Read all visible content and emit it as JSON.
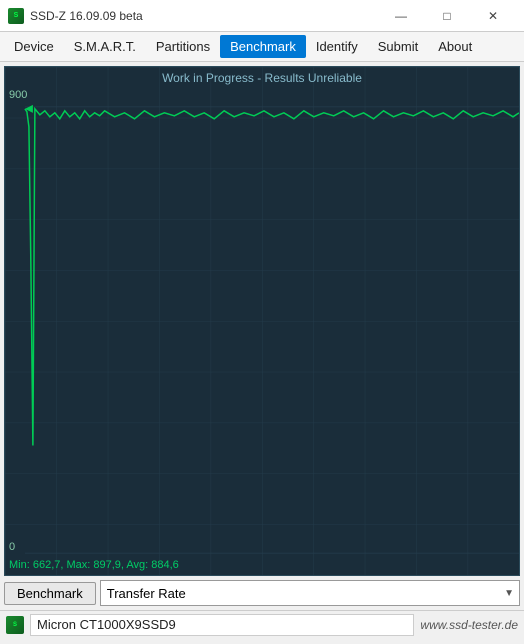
{
  "titleBar": {
    "icon": "SSD",
    "title": "SSD-Z 16.09.09 beta",
    "controls": {
      "minimize": "—",
      "maximize": "□",
      "close": "✕"
    }
  },
  "menuBar": {
    "items": [
      {
        "id": "device",
        "label": "Device",
        "active": false
      },
      {
        "id": "smart",
        "label": "S.M.A.R.T.",
        "active": false
      },
      {
        "id": "partitions",
        "label": "Partitions",
        "active": false
      },
      {
        "id": "benchmark",
        "label": "Benchmark",
        "active": true
      },
      {
        "id": "identify",
        "label": "Identify",
        "active": false
      },
      {
        "id": "submit",
        "label": "Submit",
        "active": false
      },
      {
        "id": "about",
        "label": "About",
        "active": false
      }
    ]
  },
  "chart": {
    "topLabel": "Work in Progress - Results Unreliable",
    "yMax": "900",
    "yMin": "0",
    "stats": "Min: 662,7, Max: 897,9, Avg: 884,6",
    "bgColor": "#1a2d3a",
    "gridColor": "#243d4d",
    "lineColor": "#00cc55"
  },
  "toolbar": {
    "benchmarkLabel": "Benchmark",
    "selectOptions": [
      "Transfer Rate"
    ],
    "selectValue": "Transfer Rate",
    "arrowIcon": "▼"
  },
  "statusBar": {
    "drive": "Micron CT1000X9SSD9",
    "website": "www.ssd-tester.de"
  }
}
